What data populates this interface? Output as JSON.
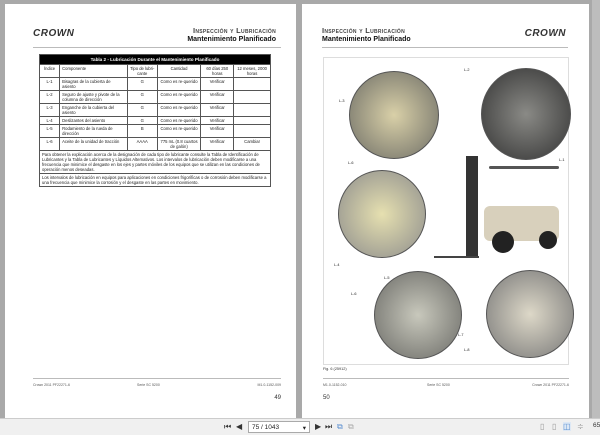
{
  "viewer": {
    "page_field": "75 / 1043",
    "zoom": "65",
    "icons": [
      "first-page-icon",
      "prev-page-icon",
      "page-dropdown-icon",
      "next-page-icon",
      "last-page-icon",
      "rotate-icon",
      "copy-icon",
      "single-page-icon",
      "continuous-icon",
      "two-page-icon",
      "scroll-mode-icon"
    ]
  },
  "left_page": {
    "logo": "CROWN",
    "section": "Inspección y Lubricación",
    "subtitle": "Mantenimiento Planificado",
    "table": {
      "caption": "Tabla 2 - Lubricación Durante el Mantenimiento Planificado",
      "headers": [
        "Índice",
        "Componente",
        "Tipo de lubri-cante",
        "Cantidad",
        "60 días 250 horas",
        "12 meses, 2000 horas"
      ],
      "rows": [
        [
          "L-1",
          "Bisagras de la cubierta de asiento",
          "G",
          "Como es re-querido",
          "Verificar",
          ""
        ],
        [
          "L-2",
          "Seguro de ajuste y pivote de la columna de dirección",
          "G",
          "Como es re-querido",
          "Verificar",
          ""
        ],
        [
          "L-3",
          "Enganche de la cubierta del asiento",
          "G",
          "Como es re-querido",
          "Verificar",
          ""
        ],
        [
          "L-4",
          "Deslizantes del asiento",
          "G",
          "Como es re-querido",
          "Verificar",
          ""
        ],
        [
          "L-5",
          "Rodamiento de la rueda de dirección",
          "B",
          "Como es re-querido",
          "Verificar",
          ""
        ],
        [
          "L-6",
          "Aceite de la unidad de tracción",
          "AAAA",
          "775 mL (0.8 cuartos de galón)",
          "Verificar",
          "Cambiar"
        ]
      ],
      "note1": "Para obtener la explicación acerca de la designación de cada tipo de lubricante consulte la Tabla de Identificación de Lubricantes y la Tabla de Lubricantes y Líquidos Alternativos. Los intervalos de lubricación deben modificarse a una frecuencia que minimice el desgaste en los ejes y partes móviles de los equipos que se utilizan en las condiciones de operación menos deseadas.",
      "note2": "Los intervalos de lubricación en equipos para aplicaciones en condiciones frigoríficas o de corrosión deben modificarse a una frecuencia que minimice la corrosión y el desgaste en las partes en movimiento."
    },
    "footer": {
      "left": "Crown 2011 PF22271-6",
      "center": "Serie SC 5200",
      "right": "M1.0-1152-009"
    },
    "page_number": "49"
  },
  "right_page": {
    "logo": "CROWN",
    "section": "Inspección y Lubricación",
    "subtitle": "Mantenimiento Planificado",
    "figure_labels": [
      "L-2",
      "L-3",
      "L-1",
      "L-6",
      "L-4",
      "L-5",
      "L-6",
      "L-7",
      "L-8"
    ],
    "caption": "Fig. 6 (25912)",
    "footer": {
      "left": "M1.0-1152-010",
      "center": "Serie SC 5200",
      "right": "Crown 2011 PF22271-6"
    },
    "page_number": "50"
  }
}
